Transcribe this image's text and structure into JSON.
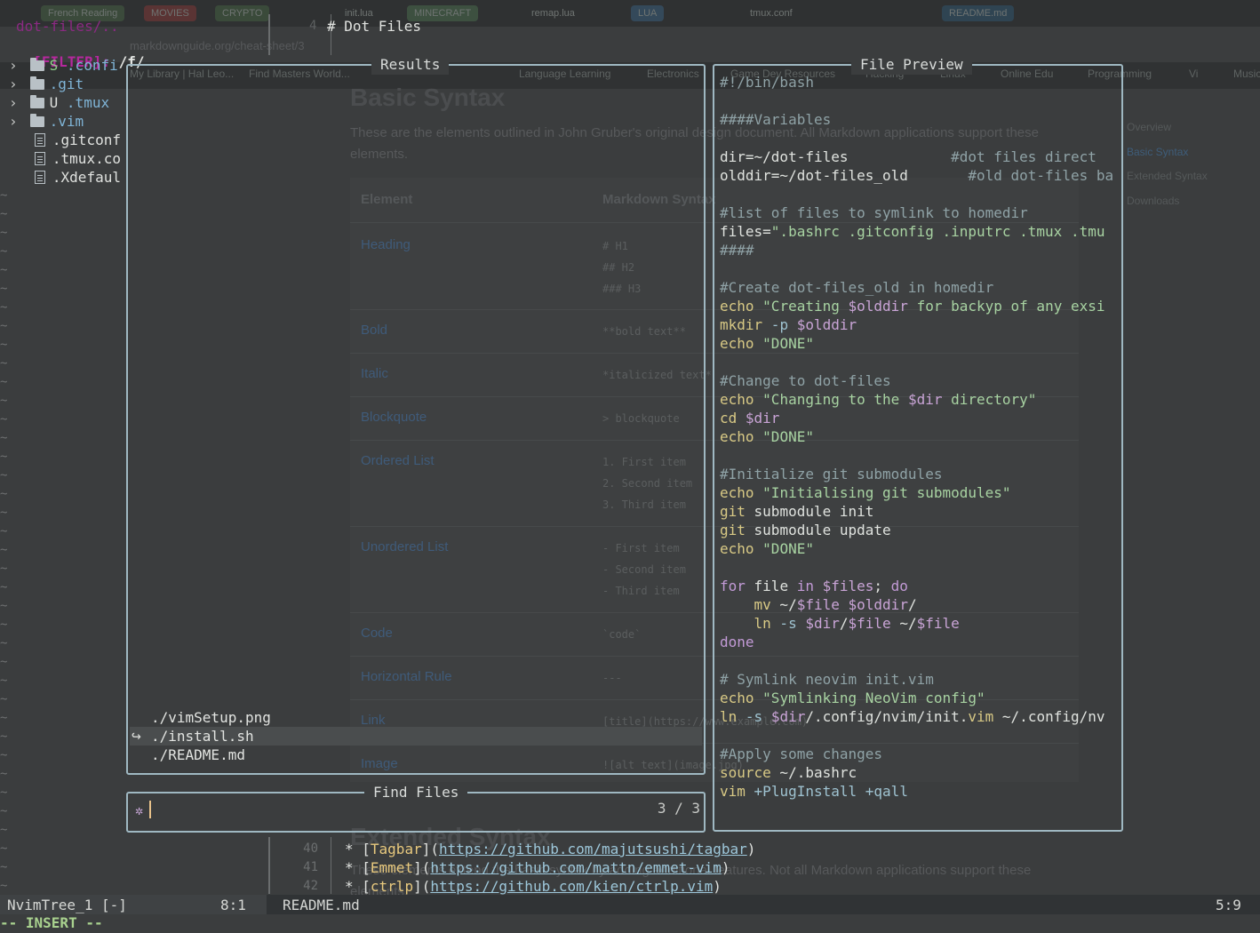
{
  "background_page": {
    "tabs": [
      "French Reading",
      "MOVIES",
      "CRYPTO",
      "init.lua",
      "MINECRAFT",
      "remap.lua",
      "LUA",
      "tmux.conf",
      "README.md"
    ],
    "url": "markdownguide.org/cheat-sheet/3",
    "bookmarks": [
      "My Library | Hal Leo...",
      "Find Masters World...",
      "Language Learning",
      "Electronics",
      "Game Dev Resources",
      "Hacking",
      "Linux",
      "Online Edu",
      "Programming",
      "Vi",
      "Music"
    ],
    "heading": "Basic Syntax",
    "intro": "These are the elements outlined in John Gruber's original design document. All Markdown applications support these elements.",
    "table_headers": [
      "Element",
      "Markdown Syntax"
    ],
    "rows": [
      {
        "element": "Heading",
        "syntax": "# H1\n## H2\n### H3"
      },
      {
        "element": "Bold",
        "syntax": "**bold text**"
      },
      {
        "element": "Italic",
        "syntax": "*italicized text*"
      },
      {
        "element": "Blockquote",
        "syntax": "> blockquote"
      },
      {
        "element": "Ordered List",
        "syntax": "1. First item\n2. Second item\n3. Third item"
      },
      {
        "element": "Unordered List",
        "syntax": "- First item\n- Second item\n- Third item"
      },
      {
        "element": "Code",
        "syntax": "`code`"
      },
      {
        "element": "Horizontal Rule",
        "syntax": "---"
      },
      {
        "element": "Link",
        "syntax": "[title](https://www.example.com)"
      },
      {
        "element": "Image",
        "syntax": "![alt text](image.jpg)"
      }
    ],
    "toc": [
      "Overview",
      "Basic Syntax",
      "Extended Syntax",
      "Downloads"
    ],
    "extended_heading": "Extended Syntax",
    "extended_intro": "These elements extend the basic syntax by adding additional features. Not all Markdown applications support these elements."
  },
  "tree": {
    "root": "dot-files/..",
    "filter_label": "[FILTER]:",
    "filter_value": "/f/",
    "items": [
      {
        "name": ".confi",
        "type": "folder",
        "git": "S"
      },
      {
        "name": ".git",
        "type": "folder",
        "git": ""
      },
      {
        "name": ".tmux",
        "type": "folder",
        "git": "U"
      },
      {
        "name": ".vim",
        "type": "folder",
        "git": ""
      },
      {
        "name": ".gitconf",
        "type": "file",
        "git": ""
      },
      {
        "name": ".tmux.co",
        "type": "file",
        "git": ""
      },
      {
        "name": ".Xdefaul",
        "type": "file",
        "git": ""
      }
    ],
    "filler": "~"
  },
  "editor": {
    "top_line_no": "4",
    "top_line_text": "# Dot Files",
    "bottom_lines": [
      {
        "no": "40",
        "name": "Tagbar",
        "url": "https://github.com/majutsushi/tagbar"
      },
      {
        "no": "41",
        "name": "Emmet",
        "url": "https://github.com/mattn/emmet-vim"
      },
      {
        "no": "42",
        "name": "ctrlp",
        "url": "https://github.com/kien/ctrlp.vim"
      }
    ]
  },
  "telescope": {
    "results_title": "Results",
    "results": [
      "./vimSetup.png",
      "./install.sh",
      "./README.md"
    ],
    "selected_index": 1,
    "selection_marker": "↪",
    "prompt_title": "Find Files",
    "prompt_icon": "telescope-icon",
    "prompt_value": "",
    "counter": "3 / 3",
    "preview_title": "File Preview"
  },
  "preview_lines": [
    "#!/bin/bash",
    "",
    "####Variables",
    "",
    "dir=~/dot-files            #dot files direct",
    "olddir=~/dot-files_old       #old dot-files ba",
    "",
    "#list of files to symlink to homedir",
    "files=\".bashrc .gitconfig .inputrc .tmux .tmu",
    "####",
    "",
    "#Create dot-files_old in homedir",
    "echo \"Creating $olddir for backyp of any exsi",
    "mkdir -p $olddir",
    "echo \"DONE\"",
    "",
    "#Change to dot-files",
    "echo \"Changing to the $dir directory\"",
    "cd $dir",
    "echo \"DONE\"",
    "",
    "#Initialize git submodules",
    "echo \"Initialising git submodules\"",
    "git submodule init",
    "git submodule update",
    "echo \"DONE\"",
    "",
    "for file in $files; do",
    "    mv ~/$file $olddir/",
    "    ln -s $dir/$file ~/$file",
    "done",
    "",
    "# Symlink neovim init.vim",
    "echo \"Symlinking NeoVim config\"",
    "ln -s $dir/.config/nvim/init.vim ~/.config/nv",
    "",
    "#Apply some changes",
    "source ~/.bashrc",
    "vim +PlugInstall +qall"
  ],
  "statusline": {
    "left_name": "NvimTree_1 [-]",
    "left_pos": "8:1",
    "file": "README.md",
    "right_pos": "5:9"
  },
  "mode": "-- INSERT --",
  "colors": {
    "border": "#9fb8c2",
    "tree_root": "#8b2a82",
    "filter_label": "#b5289d",
    "comment": "#8fa2a6",
    "string": "#a8d3a2",
    "variable": "#c9a4d6",
    "mode": "#a9d28f"
  }
}
